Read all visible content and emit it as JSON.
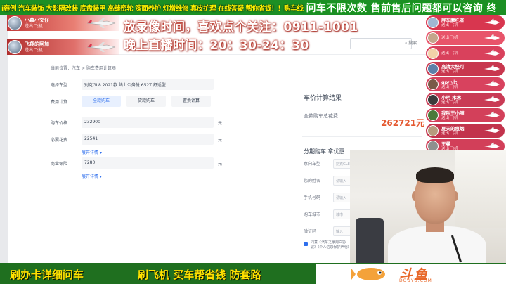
{
  "ticker": {
    "left_text": "i容例 汽车装饰 大影隔改装 底盘装甲 高缝密轮 漆面养护 灯增维修 真皮护理 在线答疑 帮你省钱！！购车线",
    "right_text": "问车不限次数 售前售后问题都可以咨询 终"
  },
  "announce": {
    "line1": "放录像时间，喜欢点个关注：0911-1001",
    "line2": "晚上直播时间：20：30-24：30"
  },
  "gift_banners": [
    {
      "name": "小慕小文仔",
      "sub": "送出 飞机"
    },
    {
      "name": "飞翔的阿加",
      "sub": "送出 飞机"
    }
  ],
  "gift_column": [
    {
      "name": "胖车摩托者",
      "sub": "送出 飞机",
      "color": "#d8364f"
    },
    {
      "name": "",
      "sub": "送出 飞机",
      "color": "#e8546a"
    },
    {
      "name": "",
      "sub": "送出 飞机",
      "color": "#d9415c"
    },
    {
      "name": "高清大怪可",
      "sub": "送出 飞机",
      "color": "#c8374e"
    },
    {
      "name": "qp小七",
      "sub": "送出 飞机",
      "color": "#d8425e"
    },
    {
      "name": "小明 木木",
      "sub": "送出 飞机",
      "color": "#c93b55"
    },
    {
      "name": "我叫王小喵",
      "sub": "送出 飞机",
      "color": "#d3405a"
    },
    {
      "name": "夏天的痕烟",
      "sub": "送出 飞机",
      "color": "#c2334c"
    },
    {
      "name": "王曼",
      "sub": "送出 飞机",
      "color": "#d23f59"
    }
  ],
  "site": {
    "search_btn": "搜索",
    "breadcrumb": "当前位置：汽车 > 购车费用计算器"
  },
  "form": {
    "rows": [
      {
        "label": "选择车型",
        "value": "别克GL8 2021款 陆上公务舱 652T 舒适型",
        "unit": ""
      },
      {
        "label": "费用计算",
        "value": "",
        "unit": ""
      },
      {
        "label": "购车价格",
        "value": "232900",
        "unit": "元"
      },
      {
        "label": "必要花费",
        "value": "22541",
        "unit": "元"
      },
      {
        "label": "商业保险",
        "value": "7280",
        "unit": "元"
      }
    ],
    "tabs": [
      "全款购车",
      "贷款购车",
      "置换计算"
    ],
    "detail_link_1": "展开详情 ▾",
    "detail_link_2": "展开详情 ▾"
  },
  "result": {
    "title": "车价计算结果",
    "total_label": "全款购车总花费",
    "total_value": "262721元",
    "sub_title": "分期购车 拿优惠",
    "fields": [
      "意向车型",
      "您的姓名",
      "手机号码",
      "购车城市",
      "验证码"
    ],
    "placeholders": [
      "别克GL8",
      "请输入",
      "请输入",
      "城市",
      "输入"
    ],
    "note": "同意《汽车之家用户协议》《个人信息保护声明》"
  },
  "bottom": {
    "left_text": "刷办卡详细问车",
    "middle_text": "刷飞机 买车帮省钱 防套路",
    "logo_text": "斗鱼",
    "logo_url": "DOUYU.COM"
  },
  "colors": {
    "ticker_bg": "#1c8f24",
    "ticker_left": "#fff200",
    "bottom_bg": "#1f6f1f",
    "bottom_text": "#ffe100",
    "total_price": "#e4572e",
    "link_blue": "#2f6fed",
    "logo_orange": "#e8682a"
  },
  "icons": [
    "plane-icon",
    "search-icon",
    "checkbox-icon",
    "fish-logo-icon",
    "avatar-icon"
  ]
}
